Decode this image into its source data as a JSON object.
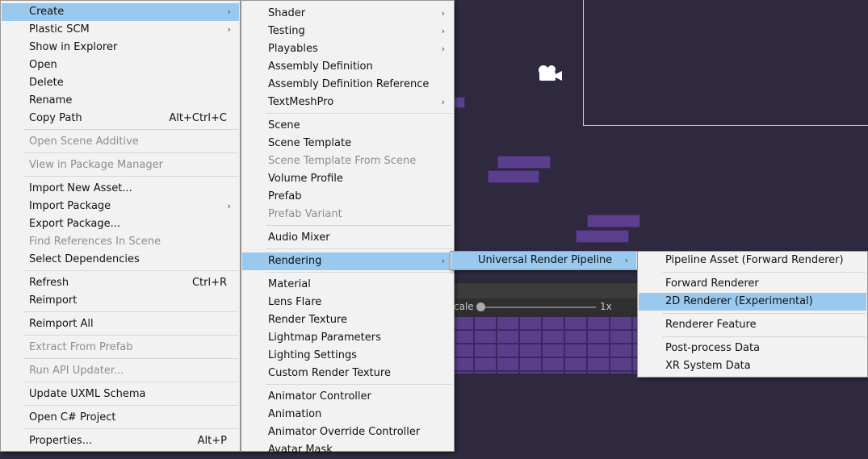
{
  "menu_main": {
    "items": [
      {
        "label": "Create",
        "arrow": "›"
      },
      {
        "label": "Plastic SCM",
        "arrow": "›"
      },
      {
        "label": "Show in Explorer"
      },
      {
        "label": "Open"
      },
      {
        "label": "Delete"
      },
      {
        "label": "Rename"
      },
      {
        "label": "Copy Path",
        "shortcut": "Alt+Ctrl+C"
      },
      {
        "label": "Open Scene Additive"
      },
      {
        "label": "View in Package Manager"
      },
      {
        "label": "Import New Asset..."
      },
      {
        "label": "Import Package",
        "arrow": "›"
      },
      {
        "label": "Export Package..."
      },
      {
        "label": "Find References In Scene"
      },
      {
        "label": "Select Dependencies"
      },
      {
        "label": "Refresh",
        "shortcut": "Ctrl+R"
      },
      {
        "label": "Reimport"
      },
      {
        "label": "Reimport All"
      },
      {
        "label": "Extract From Prefab"
      },
      {
        "label": "Run API Updater..."
      },
      {
        "label": "Update UXML Schema"
      },
      {
        "label": "Open C# Project"
      },
      {
        "label": "Properties...",
        "shortcut": "Alt+P"
      }
    ]
  },
  "menu_create": {
    "items": [
      {
        "label": "Shader",
        "arrow": "›"
      },
      {
        "label": "Testing",
        "arrow": "›"
      },
      {
        "label": "Playables",
        "arrow": "›"
      },
      {
        "label": "Assembly Definition"
      },
      {
        "label": "Assembly Definition Reference"
      },
      {
        "label": "TextMeshPro",
        "arrow": "›"
      },
      {
        "label": "Scene"
      },
      {
        "label": "Scene Template"
      },
      {
        "label": "Scene Template From Scene"
      },
      {
        "label": "Volume Profile"
      },
      {
        "label": "Prefab"
      },
      {
        "label": "Prefab Variant"
      },
      {
        "label": "Audio Mixer"
      },
      {
        "label": "Rendering",
        "arrow": "›"
      },
      {
        "label": "Material"
      },
      {
        "label": "Lens Flare"
      },
      {
        "label": "Render Texture"
      },
      {
        "label": "Lightmap Parameters"
      },
      {
        "label": "Lighting Settings"
      },
      {
        "label": "Custom Render Texture"
      },
      {
        "label": "Animator Controller"
      },
      {
        "label": "Animation"
      },
      {
        "label": "Animator Override Controller"
      },
      {
        "label": "Avatar Mask"
      }
    ]
  },
  "menu_rendering": {
    "items": [
      {
        "label": "Universal Render Pipeline",
        "arrow": "›"
      }
    ]
  },
  "menu_urp": {
    "items": [
      {
        "label": "Pipeline Asset (Forward Renderer)"
      },
      {
        "label": "Forward Renderer"
      },
      {
        "label": "2D Renderer (Experimental)"
      },
      {
        "label": "Renderer Feature"
      },
      {
        "label": "Post-process Data"
      },
      {
        "label": "XR System Data"
      }
    ]
  },
  "game_view": {
    "scale_label": "cale",
    "scale_value": "1x"
  },
  "colors": {
    "highlight": "#99c9ef",
    "menu_bg": "#f2f2f2",
    "scene_bg": "#2f293f",
    "disabled_text": "#8d8d8d"
  }
}
